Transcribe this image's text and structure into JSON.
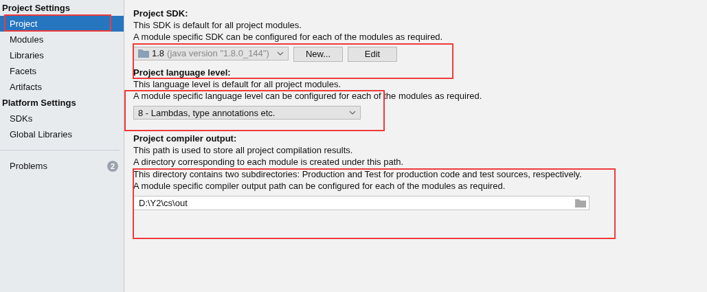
{
  "sidebar": {
    "sections": [
      {
        "title": "Project Settings",
        "items": [
          {
            "label": "Project",
            "selected": true
          },
          {
            "label": "Modules",
            "selected": false
          },
          {
            "label": "Libraries",
            "selected": false
          },
          {
            "label": "Facets",
            "selected": false
          },
          {
            "label": "Artifacts",
            "selected": false
          }
        ]
      },
      {
        "title": "Platform Settings",
        "items": [
          {
            "label": "SDKs",
            "selected": false
          },
          {
            "label": "Global Libraries",
            "selected": false
          }
        ]
      }
    ],
    "footer_items": [
      {
        "label": "Problems",
        "badge": "2",
        "selected": false
      }
    ]
  },
  "sdk": {
    "title": "Project SDK:",
    "lines": [
      "This SDK is default for all project modules.",
      "A module specific SDK can be configured for each of the modules as required."
    ],
    "combo": {
      "version": "1.8",
      "detail": "(java version \"1.8.0_144\")"
    },
    "buttons": [
      "New...",
      "Edit"
    ]
  },
  "language_level": {
    "title": "Project language level:",
    "lines": [
      "This language level is default for all project modules.",
      "A module specific language level can be configured for each of the modules as required."
    ],
    "combo": {
      "value": "8 - Lambdas, type annotations etc."
    }
  },
  "compiler_output": {
    "title": "Project compiler output:",
    "lines": [
      "This path is used to store all project compilation results.",
      "A directory corresponding to each module is created under this path.",
      "This directory contains two subdirectories: Production and Test for production code and test sources, respectively.",
      "A module specific compiler output path can be configured for each of the modules as required."
    ],
    "path": "D:\\Y2\\cs\\out"
  }
}
